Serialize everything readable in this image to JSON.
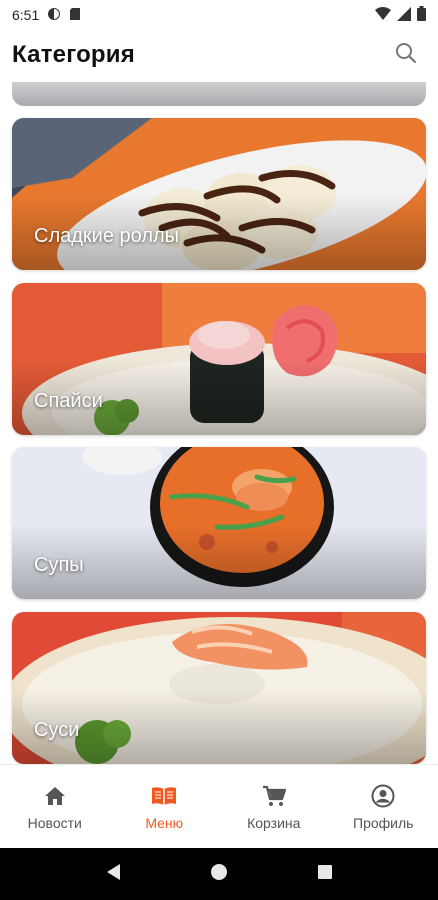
{
  "status_bar": {
    "time": "6:51"
  },
  "header": {
    "title": "Категория"
  },
  "categories": [
    {
      "label": "Сладкие роллы"
    },
    {
      "label": "Спайси"
    },
    {
      "label": "Супы"
    },
    {
      "label": "Суси"
    }
  ],
  "bottom_nav": {
    "items": [
      {
        "label": "Новости",
        "icon": "home-icon"
      },
      {
        "label": "Меню",
        "icon": "book-icon",
        "active": true
      },
      {
        "label": "Корзина",
        "icon": "cart-icon"
      },
      {
        "label": "Профиль",
        "icon": "account-icon"
      }
    ]
  },
  "colors": {
    "accent": "#f05a22",
    "inactive": "#555555"
  }
}
